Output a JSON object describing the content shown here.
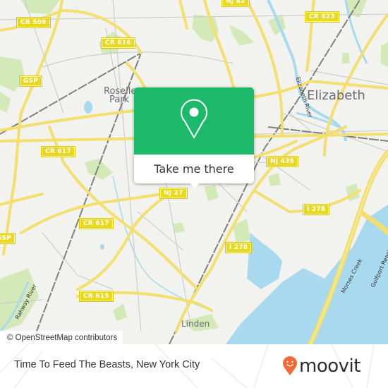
{
  "map": {
    "road_shields": [
      {
        "label": "CR 509",
        "id": "cr-509"
      },
      {
        "label": "CR 616",
        "id": "cr-616"
      },
      {
        "label": "GSP",
        "id": "gsp"
      },
      {
        "label": "CR 617",
        "id": "cr-617-north"
      },
      {
        "label": "CR 617",
        "id": "cr-617-south"
      },
      {
        "label": "GSP",
        "id": "gsp-south"
      },
      {
        "label": "CR 615",
        "id": "cr-615"
      },
      {
        "label": "NJ 27",
        "id": "nj-27"
      },
      {
        "label": "NJ 82",
        "id": "nj-82"
      },
      {
        "label": "CR 623",
        "id": "cr-623"
      },
      {
        "label": "NJ 439",
        "id": "nj-439"
      },
      {
        "label": "I 278",
        "id": "i-278-east"
      },
      {
        "label": "I 278",
        "id": "i-278-south"
      }
    ],
    "places": [
      {
        "label": "Roselle",
        "id": "roselle"
      },
      {
        "label": "Park",
        "id": "park"
      },
      {
        "label": "Elizabeth",
        "id": "elizabeth"
      },
      {
        "label": "Linden",
        "id": "linden"
      }
    ],
    "water_labels": [
      {
        "label": "Elizabeth River"
      },
      {
        "label": "Rahway River"
      },
      {
        "label": "Morses Creek"
      },
      {
        "label": "Gulfport Reach"
      }
    ],
    "colors": {
      "land": "#f2f2ee",
      "road_major": "#f5e37a",
      "water": "#a8d8ee",
      "park": "#cfe8b0",
      "rail": "#777777",
      "accent_green": "#1db96b",
      "moovit_orange": "#f26a36"
    }
  },
  "popup": {
    "icon": "map-pin-icon",
    "button_label": "Take me there"
  },
  "attribution": "© OpenStreetMap contributors",
  "footer": {
    "title": "Time To Feed The Beasts, New York City",
    "logo_text": "moovit"
  }
}
